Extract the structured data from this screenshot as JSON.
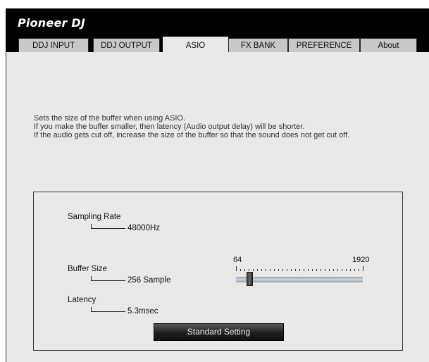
{
  "app": {
    "brand": "Pioneer DJ"
  },
  "tabs": [
    {
      "label": "DDJ INPUT"
    },
    {
      "label": "DDJ OUTPUT"
    },
    {
      "label": "ASIO"
    },
    {
      "label": "FX BANK"
    },
    {
      "label": "PREFERENCE"
    },
    {
      "label": "About"
    }
  ],
  "active_tab": "ASIO",
  "description": {
    "line1": "Sets the size of the buffer when using ASIO.",
    "line2": "If you make the buffer smaller, then latency (Audio output delay) will be shorter.",
    "line3": "If the audio gets cut off, increase the size of the buffer so that the sound does not get cut off."
  },
  "settings": {
    "sampling_rate": {
      "label": "Sampling Rate",
      "value": "48000Hz"
    },
    "buffer_size": {
      "label": "Buffer Size",
      "value": "256 Sample"
    },
    "latency": {
      "label": "Latency",
      "value": "5.3msec"
    }
  },
  "slider": {
    "min_label": "64",
    "max_label": "1920",
    "min": 64,
    "max": 1920,
    "value": 256
  },
  "standard_button": {
    "label": "Standard Setting"
  },
  "colors": {
    "background": "#e9e9e9",
    "topbar": "#000000",
    "tab": "#c8c8c8"
  }
}
